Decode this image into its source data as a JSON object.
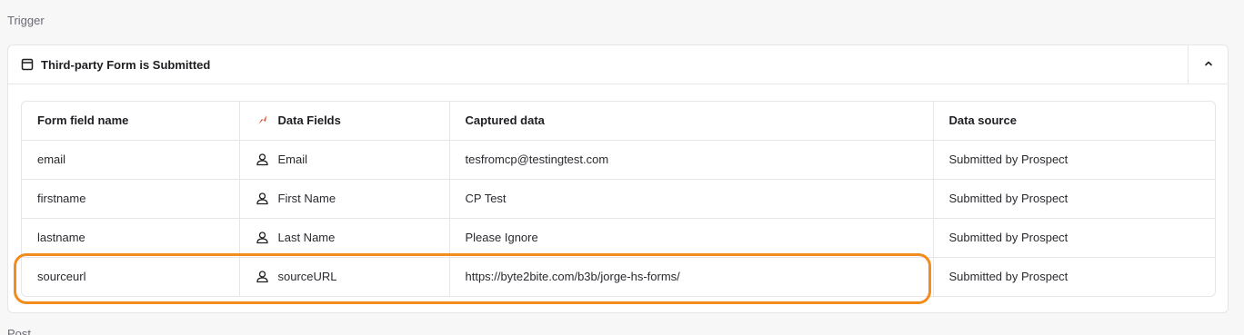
{
  "section": {
    "label": "Trigger",
    "next_label": "Post"
  },
  "trigger": {
    "icon": "form-icon",
    "title": "Third-party Form is Submitted",
    "collapse_icon": "chevron-up-icon"
  },
  "table": {
    "headers": [
      "Form field name",
      "Data Fields",
      "Captured data",
      "Data source"
    ],
    "data_fields_icon": "brand-logo-icon",
    "rows": [
      {
        "field": "email",
        "data_field": "Email",
        "captured": "tesfromcp@testingtest.com",
        "source": "Submitted by Prospect"
      },
      {
        "field": "firstname",
        "data_field": "First Name",
        "captured": "CP Test",
        "source": "Submitted by Prospect"
      },
      {
        "field": "lastname",
        "data_field": "Last Name",
        "captured": "Please Ignore",
        "source": "Submitted by Prospect"
      },
      {
        "field": "sourceurl",
        "data_field": "sourceURL",
        "captured": "https://byte2bite.com/b3b/jorge-hs-forms/",
        "source": "Submitted by Prospect"
      }
    ]
  },
  "colors": {
    "highlight": "#f28c1e",
    "brand": "#e0401b"
  }
}
